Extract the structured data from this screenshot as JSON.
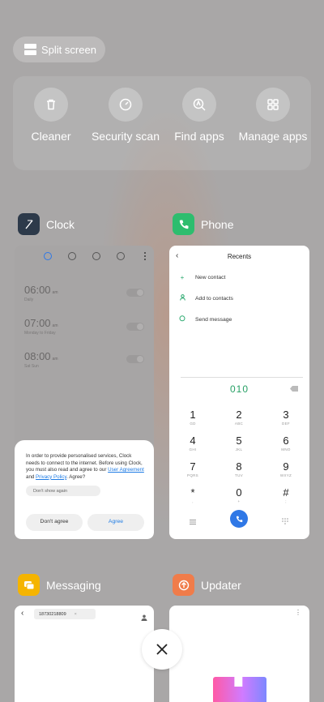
{
  "split_screen": {
    "label": "Split screen",
    "icon": "split-screen-icon"
  },
  "quick_actions": [
    {
      "label": "Cleaner",
      "icon": "trash-icon"
    },
    {
      "label": "Security scan",
      "icon": "shield-check-icon"
    },
    {
      "label": "Find apps",
      "icon": "search-apps-icon"
    },
    {
      "label": "Manage apps",
      "icon": "grid-icon"
    }
  ],
  "apps": {
    "clock": {
      "name": "Clock",
      "icon": "clock-app-icon",
      "alarms": [
        {
          "time": "06:00",
          "ampm": "am",
          "sub": "Daily"
        },
        {
          "time": "07:00",
          "ampm": "am",
          "sub": "Monday to Friday"
        },
        {
          "time": "08:00",
          "ampm": "am",
          "sub": "Sat Sun"
        }
      ],
      "dialog": {
        "text_before": "In order to provide personalised services, Clock needs to connect to the internet. Before using Clock, you must also read and agree to our ",
        "link1": "User Agreement",
        "and": " and ",
        "link2": "Privacy Policy",
        "text_after": ". Agree?",
        "checkbox": "Don't show again",
        "disagree": "Don't agree",
        "agree": "Agree"
      }
    },
    "phone": {
      "name": "Phone",
      "icon": "phone-app-icon",
      "title": "Recents",
      "menu": [
        {
          "label": "New contact",
          "icon": "+"
        },
        {
          "label": "Add to contacts",
          "icon": "person-icon"
        },
        {
          "label": "Send message",
          "icon": "message-icon"
        }
      ],
      "dialed": "010",
      "keys": [
        {
          "d": "1",
          "l": "GD"
        },
        {
          "d": "2",
          "l": "ABC"
        },
        {
          "d": "3",
          "l": "DEF"
        },
        {
          "d": "4",
          "l": "GHI"
        },
        {
          "d": "5",
          "l": "JKL"
        },
        {
          "d": "6",
          "l": "MNO"
        },
        {
          "d": "7",
          "l": "PQRS"
        },
        {
          "d": "8",
          "l": "TUV"
        },
        {
          "d": "9",
          "l": "WXYZ"
        },
        {
          "d": "*",
          "l": ","
        },
        {
          "d": "0",
          "l": "+"
        },
        {
          "d": "#",
          "l": ";"
        }
      ]
    },
    "messaging": {
      "name": "Messaging",
      "icon": "messaging-app-icon",
      "recipient": "18730218809"
    },
    "updater": {
      "name": "Updater",
      "icon": "updater-app-icon"
    }
  },
  "close": {
    "icon": "close-icon"
  },
  "colors": {
    "background": "#a9a7a7",
    "accent_blue": "#2f78e6",
    "phone_green": "#27a065",
    "clock_icon": "#2d3a4a",
    "phone_icon": "#2dbd6e",
    "messaging_icon": "#f5b400",
    "updater_icon": "#f07c4a"
  }
}
